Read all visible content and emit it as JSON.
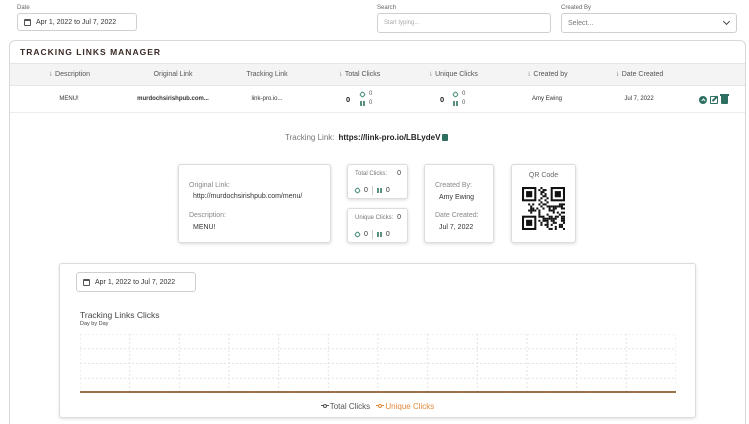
{
  "filters": {
    "date_label": "Date",
    "date_value": "Apr 1, 2022 to Jul 7, 2022",
    "search_label": "Search",
    "search_placeholder": "Start typing...",
    "created_by_label": "Created By",
    "created_by_value": "Select..."
  },
  "panel": {
    "title": "TRACKING LINKS MANAGER",
    "columns": [
      "Description",
      "Original Link",
      "Tracking Link",
      "Total Clicks",
      "Unique Clicks",
      "Created by",
      "Date Created"
    ]
  },
  "row": {
    "description": "MENU!",
    "original_link": "murdochsirishpub.com...",
    "tracking_link": "link-pro.io...",
    "total_clicks": "0",
    "total_link_clicks": "0",
    "total_qr_clicks": "0",
    "unique_clicks": "0",
    "unique_link_clicks": "0",
    "unique_qr_clicks": "0",
    "created_by": "Amy Ewing",
    "date_created": "Jul 7, 2022"
  },
  "detail": {
    "tracking_label": "Tracking Link:",
    "tracking_url": "https://link-pro.io/LBLydeV",
    "original_link_label": "Original Link:",
    "original_link_value": "http://murdochsirishpub.com/menu/",
    "description_label": "Description:",
    "description_value": "MENU!",
    "total_clicks_label": "Total Clicks:",
    "total_clicks_value": "0",
    "total_link": "0",
    "total_qr": "0",
    "unique_clicks_label": "Unique Clicks:",
    "unique_clicks_value": "0",
    "unique_link": "0",
    "unique_qr": "0",
    "created_by_label": "Created By:",
    "created_by_value": "Amy Ewing",
    "date_created_label": "Date Created:",
    "date_created_value": "Jul 7, 2022",
    "qr_label": "QR Code"
  },
  "chart": {
    "date_value": "Apr 1, 2022 to Jul 7, 2022",
    "title": "Tracking Links Clicks",
    "subtitle": "Day by Day",
    "legend_total": "Total Clicks",
    "legend_unique": "Unique Clicks"
  },
  "chart_data": {
    "type": "line",
    "title": "Tracking Links Clicks",
    "subtitle": "Day by Day",
    "series": [
      {
        "name": "Total Clicks",
        "values": [
          0,
          0,
          0,
          0,
          0,
          0,
          0,
          0,
          0,
          0,
          0,
          0,
          0,
          0,
          0
        ]
      },
      {
        "name": "Unique Clicks",
        "values": [
          0,
          0,
          0,
          0,
          0,
          0,
          0,
          0,
          0,
          0,
          0,
          0,
          0,
          0,
          0
        ]
      }
    ],
    "grid": true,
    "legend": "bottom",
    "colors": {
      "Total Clicks": "#555555",
      "Unique Clicks": "#e08a3c"
    }
  }
}
